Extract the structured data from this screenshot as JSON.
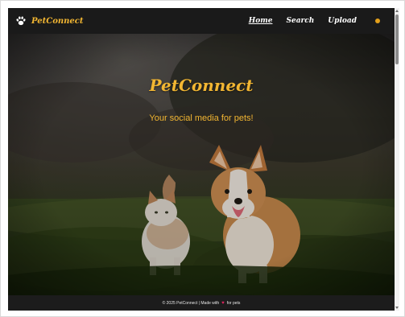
{
  "navbar": {
    "brand": {
      "name": "PetConnect",
      "icon": "paw-icon"
    },
    "links": [
      {
        "label": "Home",
        "active": true
      },
      {
        "label": "Search",
        "active": false
      },
      {
        "label": "Upload",
        "active": false
      }
    ],
    "theme_toggle": {
      "icon": "theme-dot-icon",
      "color": "#e3a01b"
    }
  },
  "hero": {
    "title": "PetConnect",
    "tagline": "Your social media for pets!"
  },
  "footer": {
    "text_before": "© 2025 PetConnect | Made with",
    "heart": "♥",
    "text_after": "for pets"
  },
  "colors": {
    "accent": "#f2b632",
    "navbar_bg": "#1a1a1a",
    "heart": "#e0245e"
  }
}
